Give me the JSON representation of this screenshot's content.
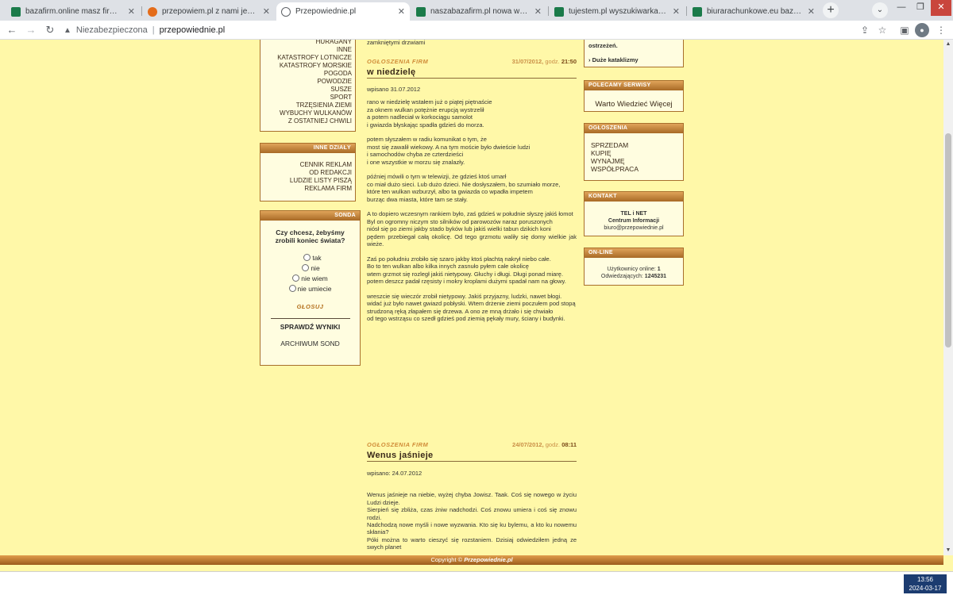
{
  "browser": {
    "tabs": [
      {
        "title": "bazafirm.online masz firmę kup a",
        "favicon_color": "#1b7b4a",
        "active": false
      },
      {
        "title": "przepowiem.pl z nami jesteś znan",
        "favicon_color": "#e46c1a",
        "active": false
      },
      {
        "title": "Przepowiednie.pl",
        "favicon_color": "#5f6368",
        "active": true
      },
      {
        "title": "naszabazafirm.pl nowa wyszukiwa",
        "favicon_color": "#1b7b4a",
        "active": false
      },
      {
        "title": "tujestem.pl wyszukiwarka naj",
        "favicon_color": "#1b7b4a",
        "active": false
      },
      {
        "title": "biurarachunkowe.eu baza firm ks",
        "favicon_color": "#1b7b4a",
        "active": false
      }
    ],
    "new_tab": "+",
    "security_label": "Niezabezpieczona",
    "url": "przepowiednie.pl"
  },
  "left": {
    "categories": [
      "HURAGANY",
      "INNE",
      "KATASTROFY LOTNICZE",
      "KATASTROFY MORSKIE",
      "POGODA",
      "POWODZIE",
      "SUSZE",
      "SPORT",
      "TRZĘSIENIA ZIEMI",
      "WYBUCHY WULKANÓW",
      "Z OSTATNIEJ CHWILI"
    ],
    "other_title": "INNE DZIAŁY",
    "other_items": [
      "CENNIK REKLAM",
      "OD REDAKCJI",
      "LUDZIE LISTY PISZĄ",
      "REKLAMA FIRM"
    ],
    "poll_title": "SONDA",
    "poll_question": "Czy chcesz, żebyśmy zrobili koniec świata?",
    "poll_options": [
      "tak",
      "nie",
      "nie wiem",
      "nie umiecie"
    ],
    "vote_label": "GŁOSUJ",
    "check_results": "SPRAWDŹ WYNIKI",
    "archive": "ARCHIWUM SOND"
  },
  "main": {
    "top_fragment": "zamkniętymi drzwiami",
    "articles": [
      {
        "category": "OGŁOSZENIA FIRM",
        "date": "31/07/2012,",
        "time_label": "godz.",
        "time": "21:50",
        "title": "w niedzielę",
        "written": "wpisano 31.07.2012",
        "paragraphs": [
          "rano w niedzielę wstałem już o piątej piętnaście\nza oknem wulkan potężnie erupcją wystrzelił\na potem nadleciał w korkociągu samolot\ni gwiazda błyskając spadła gdzieś do morza.",
          "potem słyszałem w radiu komunikat o tym, że\nmost się zawalił wiekowy. A na tym moście było dwieście ludzi\ni samochodów chyba ze czterdzieści\ni one wszystkie w morzu się znalazły.",
          "później mówili o tym w telewizji, że gdzieś ktoś umarł\nco miał dużo sieci. Lub dużo dzieci. Nie dosłyszałem, bo szumiało morze,\nktóre ten wulkan wzburzył, albo ta gwiazda co wpadła impetem\nburząc dwa miasta, które tam se stały.",
          "A to dopiero wczesnym rankiem było, zaś gdzieś w południe słyszę jakiś łomot\nByl on ogromny niczym sto silników od parowozów naraz poruszonych\nniósł się po ziemi jakby stado byków lub jakiś wielki tabun dzikich koni\npędem przebiegał całą okolicę. Od tego grzmotu waliły się domy wielkie jak wieże.",
          "Zaś po południu zrobiło się szaro jakby ktoś płachtą nakrył niebo całe.\nBo to ten wulkan albo kilka innych zasnuło pyłem całe okolicę\nwtem grzmot się rozległ jakiś nietypowy. Głuchy i długi. Długi ponad miarę.\npotem deszcz padał rzęsisty i mokry kroplami dużymi spadał nam na głowy.",
          "wreszcie się wieczór zrobił nietypowy. Jakiś przyjazny, ludzki, nawet błogi.\nwidać już było nawet gwiazd pobłyski. Wtem drżenie ziemi poczułem pod stopą\nstrudzoną ręką złapałem się drzewa. A ono ze mną drżało i się chwiało\nod tego wstrząsu co szedł gdzieś pod ziemią pękały mury, ściany i budynki."
        ]
      },
      {
        "category": "OGŁOSZENIA FIRM",
        "date": "24/07/2012,",
        "time_label": "godz.",
        "time": "08:11",
        "title": "Wenus jaśnieje",
        "written": "wpisano: 24.07.2012",
        "paragraphs": [
          "Wenus jaśnieje na niebie, wyżej chyba Jowisz. Taak. Coś się nowego w życiu Ludzi dzieje.\nSierpień się zbliża, czas żniw nadchodzi. Coś znowu umiera i coś się znowu rodzi.\nNadchodzą nowe myśli i nowe wyzwania. Kto się ku bylemu, a kto ku nowemu skłania?\nPóki można to warto cieszyć się rozstaniem. Dzisiaj odwiedziłem jedną ze swych planet"
        ]
      }
    ]
  },
  "right": {
    "top_text": "ostrzeżeń.",
    "top_link": "Duże kataklizmy",
    "recommended_title": "POLECAMY SERWISY",
    "recommended_link": "Warto Wiedzieć Więcej",
    "ads_title": "OGŁOSZENIA",
    "ads_items": [
      "SPRZEDAM",
      "KUPIĘ",
      "WYNAJMĘ",
      "WSPÓŁPRACA"
    ],
    "contact_title": "KONTAKT",
    "contact_line1": "TEL i NET",
    "contact_line2": "Centrum Informacji",
    "contact_email": "biuro@przepowiednie.pl",
    "online_title": "ON-LINE",
    "online_users_label": "Użytkownicy online:",
    "online_users": "1",
    "visits_label": "Odwiedzających:",
    "visits": "1245231"
  },
  "footer": {
    "copyright": "Copyright ©",
    "brand": "Przepowiednie.pl"
  },
  "taskbar": {
    "time": "13:56",
    "date": "2024-03-17"
  },
  "colors": {
    "page_bg": "#fff8a8",
    "box_header": "#c07a30",
    "accent_orange": "#d08c38"
  }
}
